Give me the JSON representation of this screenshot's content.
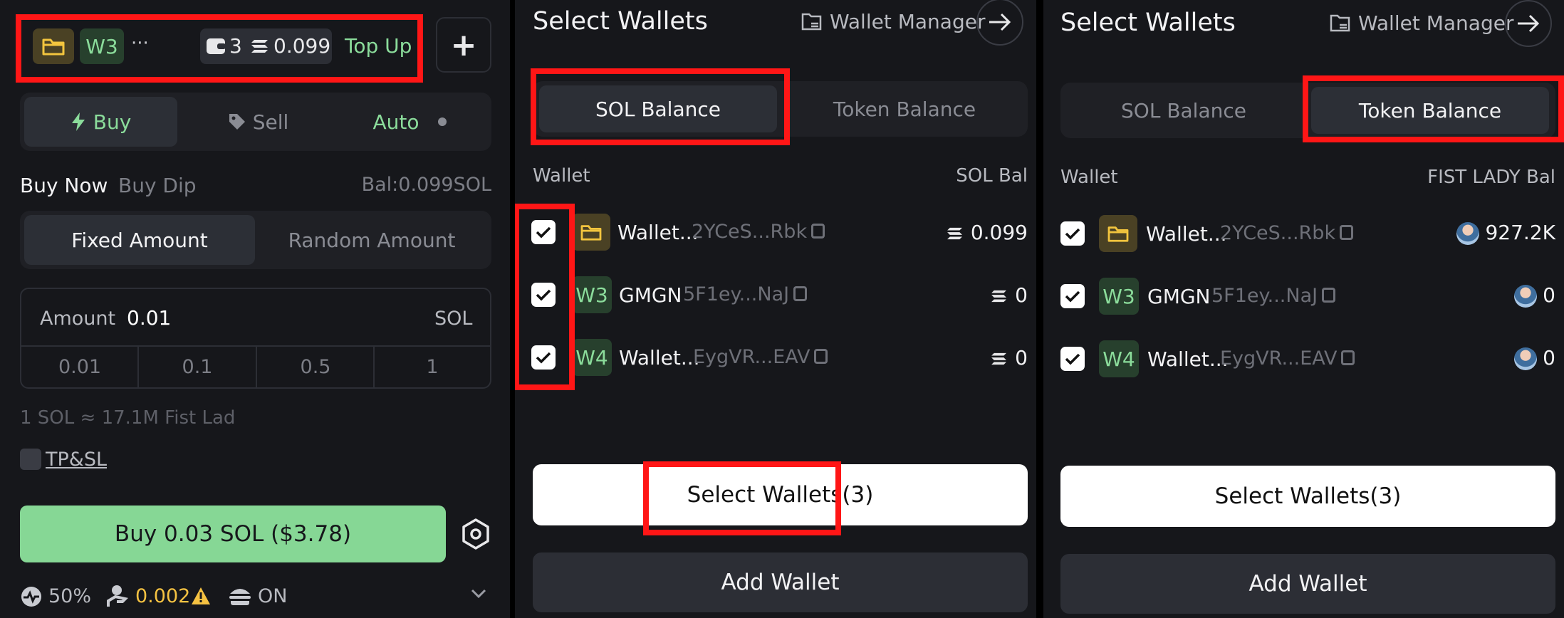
{
  "panel1": {
    "wallet_chip": "W3",
    "more": "···",
    "wallet_count": "3",
    "balance": "0.099",
    "top_up": "Top Up",
    "plus": "+",
    "tabs": {
      "buy": "Buy",
      "sell": "Sell",
      "auto": "Auto"
    },
    "subtabs": {
      "buy_now": "Buy Now",
      "buy_dip": "Buy Dip",
      "bal": "Bal:0.099SOL"
    },
    "amount_mode": {
      "fixed": "Fixed Amount",
      "random": "Random Amount"
    },
    "amount": {
      "label": "Amount",
      "value": "0.01",
      "unit": "SOL"
    },
    "presets": [
      "0.01",
      "0.1",
      "0.5",
      "1"
    ],
    "rate": "1 SOL ≈ 17.1M Fist Lad",
    "tpsl": "TP&SL",
    "buy_button": "Buy 0.03 SOL ($3.78)",
    "footer": {
      "slippage": "50%",
      "priority": "0.002",
      "mev": "ON"
    }
  },
  "panel2": {
    "title": "Select Wallets",
    "manager": "Wallet Manager",
    "tabs": {
      "sol": "SOL Balance",
      "token": "Token Balance"
    },
    "col_wallet": "Wallet",
    "col_bal": "SOL Bal",
    "rows": [
      {
        "chip": "",
        "name": "Wallet...",
        "addr": "2YCeS...Rbk",
        "bal": "0.099"
      },
      {
        "chip": "W3",
        "name": "GMGN",
        "addr": "5F1ey...NaJ",
        "bal": "0"
      },
      {
        "chip": "W4",
        "name": "Wallet...",
        "addr": "EygVR...EAV",
        "bal": "0"
      }
    ],
    "select_button": "Select Wallets(3)",
    "add_button": "Add Wallet"
  },
  "panel3": {
    "title": "Select Wallets",
    "manager": "Wallet Manager",
    "tabs": {
      "sol": "SOL Balance",
      "token": "Token Balance"
    },
    "col_wallet": "Wallet",
    "col_bal": "FIST LADY Bal",
    "rows": [
      {
        "chip": "",
        "name": "Wallet...",
        "addr": "2YCeS...Rbk",
        "bal": "927.2K"
      },
      {
        "chip": "W3",
        "name": "GMGN",
        "addr": "5F1ey...NaJ",
        "bal": "0"
      },
      {
        "chip": "W4",
        "name": "Wallet...",
        "addr": "EygVR...EAV",
        "bal": "0"
      }
    ],
    "select_button": "Select Wallets(3)",
    "add_button": "Add Wallet"
  },
  "colors": {
    "accent_green": "#8bdc9b",
    "highlight": "#ff1616",
    "background": "#16171b",
    "warning": "#f5c242"
  }
}
